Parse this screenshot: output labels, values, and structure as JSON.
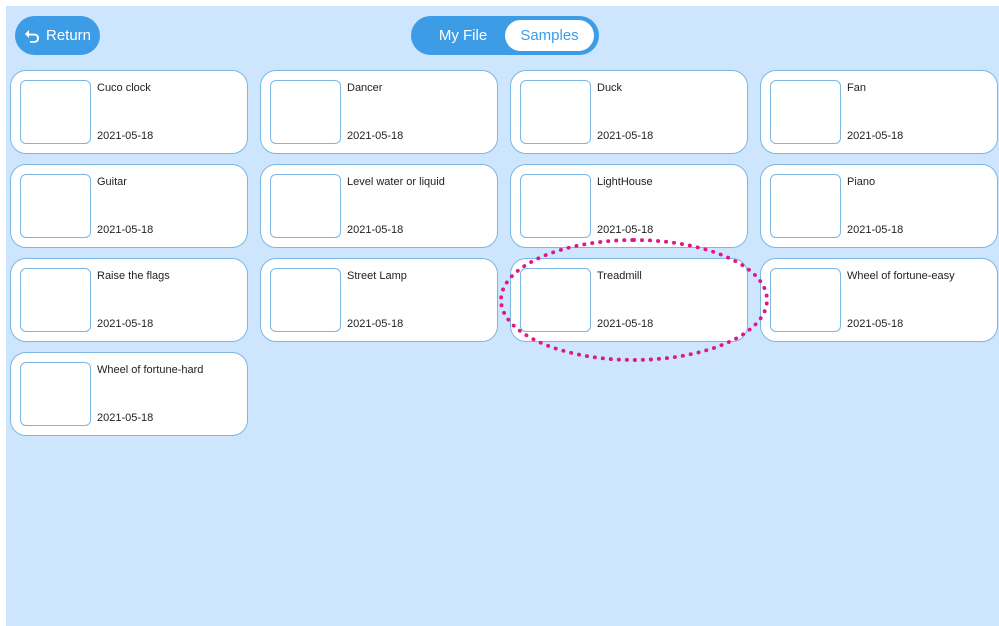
{
  "header": {
    "return_label": "Return",
    "tabs": [
      {
        "label": "My File",
        "selected": false
      },
      {
        "label": "Samples",
        "selected": true
      }
    ]
  },
  "samples": [
    {
      "title": "Cuco clock",
      "date": "2021-05-18"
    },
    {
      "title": "Dancer",
      "date": "2021-05-18"
    },
    {
      "title": "Duck",
      "date": "2021-05-18"
    },
    {
      "title": "Fan",
      "date": "2021-05-18"
    },
    {
      "title": "Guitar",
      "date": "2021-05-18"
    },
    {
      "title": "Level water or liquid",
      "date": "2021-05-18"
    },
    {
      "title": "LightHouse",
      "date": "2021-05-18"
    },
    {
      "title": "Piano",
      "date": "2021-05-18"
    },
    {
      "title": "Raise the flags",
      "date": "2021-05-18"
    },
    {
      "title": "Street Lamp",
      "date": "2021-05-18"
    },
    {
      "title": "Treadmill",
      "date": "2021-05-18"
    },
    {
      "title": "Wheel of fortune-easy",
      "date": "2021-05-18"
    },
    {
      "title": "Wheel of fortune-hard",
      "date": "2021-05-18"
    }
  ],
  "colors": {
    "background": "#cde6fd",
    "accent": "#3d9ce6",
    "card_border": "#7cb7e3",
    "highlight": "#e0168a"
  },
  "icons": {
    "return": "return-arrow-icon"
  }
}
